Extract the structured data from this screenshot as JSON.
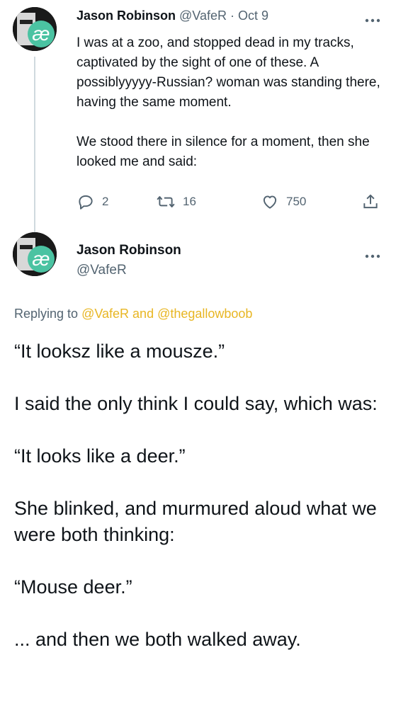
{
  "tweet1": {
    "author_name": "Jason Robinson",
    "handle": "@VafeR",
    "separator": "·",
    "date": "Oct 9",
    "more_icon": "more-horizontal-icon",
    "paragraphs": [
      "I was at a zoo, and stopped dead in my tracks, captivated by the sight of one of these. A possiblyyyyy-Russian? woman was standing there, having the same moment.",
      "We stood there in silence for a moment, then she looked me and said:"
    ],
    "actions": {
      "reply_count": "2",
      "retweet_count": "16",
      "like_count": "750",
      "icons": [
        "reply-icon",
        "retweet-icon",
        "like-icon",
        "share-icon"
      ]
    }
  },
  "tweet2": {
    "author_name": "Jason Robinson",
    "handle": "@VafeR",
    "more_icon": "more-horizontal-icon",
    "replying_prefix": "Replying to",
    "replying_handles": "@VafeR and @thegallowboob",
    "paragraphs": [
      "“It looksz like a mousze.”",
      "I said the only think I could say, which was:",
      "“It looks like a deer.”",
      "She blinked, and murmured aloud what we were both thinking:",
      "“Mouse deer.”",
      "... and then we both walked away."
    ]
  },
  "colors": {
    "text": "#0f1419",
    "muted": "#536471",
    "link": "#e8b623",
    "avatar_accent": "#4bc3a2"
  }
}
